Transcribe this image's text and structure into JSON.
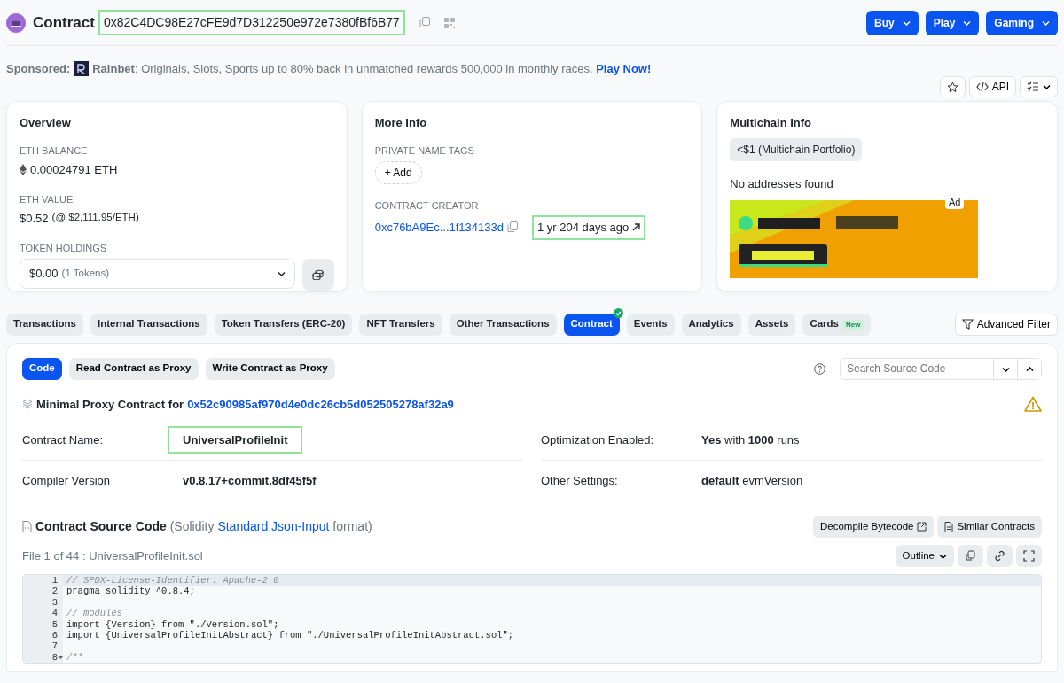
{
  "header": {
    "title": "Contract",
    "address": "0x82C4DC98E27cFE9d7D312250e972e7380fBf6B77",
    "address_highlighted": true,
    "menus": [
      {
        "label": "Buy"
      },
      {
        "label": "Play"
      },
      {
        "label": "Gaming"
      }
    ]
  },
  "sponsored": {
    "label": "Sponsored:",
    "brand": "Rainbet",
    "text": ": Originals, Slots, Sports up to 80% back in unmatched rewards 500,000 in monthly races.",
    "link": "Play Now!"
  },
  "actions": {
    "api_label": "API"
  },
  "overview": {
    "title": "Overview",
    "balance_label": "ETH BALANCE",
    "balance": "0.00024791 ETH",
    "value_label": "ETH VALUE",
    "value": "$0.52",
    "value_note": "(@ $2,111.95/ETH)",
    "token_label": "TOKEN HOLDINGS",
    "token_value": "$0.00",
    "token_note": "(1 Tokens)"
  },
  "more_info": {
    "title": "More Info",
    "tags_label": "PRIVATE NAME TAGS",
    "add_label": "+ Add",
    "creator_label": "CONTRACT CREATOR",
    "creator_address": "0xc76bA9Ec...1f134133d",
    "creator_age": "1 yr 204 days ago",
    "age_highlighted": true
  },
  "multichain": {
    "title": "Multichain Info",
    "portfolio": "<$1 (Multichain Portfolio)",
    "empty": "No addresses found",
    "ad_label": "Ad"
  },
  "tabs": [
    {
      "label": "Transactions",
      "selected": false
    },
    {
      "label": "Internal Transactions",
      "selected": false
    },
    {
      "label": "Token Transfers (ERC-20)",
      "selected": false
    },
    {
      "label": "NFT Transfers",
      "selected": false
    },
    {
      "label": "Other Transactions",
      "selected": false
    },
    {
      "label": "Contract",
      "selected": true,
      "verified": true
    },
    {
      "label": "Events",
      "selected": false
    },
    {
      "label": "Analytics",
      "selected": false
    },
    {
      "label": "Assets",
      "selected": false
    },
    {
      "label": "Cards",
      "selected": false,
      "badge": "New"
    }
  ],
  "advanced_filter": "Advanced Filter",
  "subtabs": [
    {
      "label": "Code",
      "selected": true
    },
    {
      "label": "Read Contract as Proxy",
      "selected": false
    },
    {
      "label": "Write Contract as Proxy",
      "selected": false
    }
  ],
  "search": {
    "placeholder": "Search Source Code"
  },
  "proxy": {
    "label": "Minimal Proxy Contract for",
    "address": "0x52c90985af970d4e0dc26cb5d052505278af32a9"
  },
  "details": [
    {
      "label": "Contract Name:",
      "value": "UniversalProfileInit",
      "bold": true,
      "highlighted": true
    },
    {
      "label": "Optimization Enabled:",
      "value": "**Yes** with **1000** runs",
      "bold": false,
      "highlighted": false
    },
    {
      "label": "Compiler Version",
      "value": "v0.8.17+commit.8df45f5f",
      "bold": true,
      "highlighted": false
    },
    {
      "label": "Other Settings:",
      "value": "**default** evmVersion",
      "bold": false,
      "highlighted": false
    }
  ],
  "source": {
    "title": "Contract Source Code",
    "note_before": "(Solidity",
    "link": "Standard Json-Input",
    "note_after": "format)",
    "file": "File 1 of 44 : UniversalProfileInit.sol",
    "buttons": [
      "Decompile Bytecode",
      "Similar Contracts"
    ],
    "outline": "Outline"
  },
  "code_lines": [
    {
      "number": "1",
      "text": "// SPDX-License-Identifier: Apache-2.0",
      "kind": "comment",
      "selected": true,
      "foldable": false
    },
    {
      "number": "2",
      "text": "pragma solidity ^0.8.4;",
      "kind": "code",
      "selected": false,
      "foldable": false
    },
    {
      "number": "3",
      "kind": "blank",
      "selected": false,
      "foldable": false
    },
    {
      "number": "4",
      "text": "// modules",
      "kind": "comment",
      "selected": false,
      "foldable": false
    },
    {
      "number": "5",
      "text": "import {Version} from \"./Version.sol\";",
      "kind": "code",
      "selected": false,
      "foldable": false
    },
    {
      "number": "6",
      "text": "import {UniversalProfileInitAbstract} from \"./UniversalProfileInitAbstract.sol\";",
      "kind": "code",
      "selected": false,
      "foldable": false
    },
    {
      "number": "7",
      "kind": "blank",
      "selected": false,
      "foldable": false
    },
    {
      "number": "8",
      "text": "/**",
      "kind": "comment",
      "selected": false,
      "foldable": true
    }
  ]
}
